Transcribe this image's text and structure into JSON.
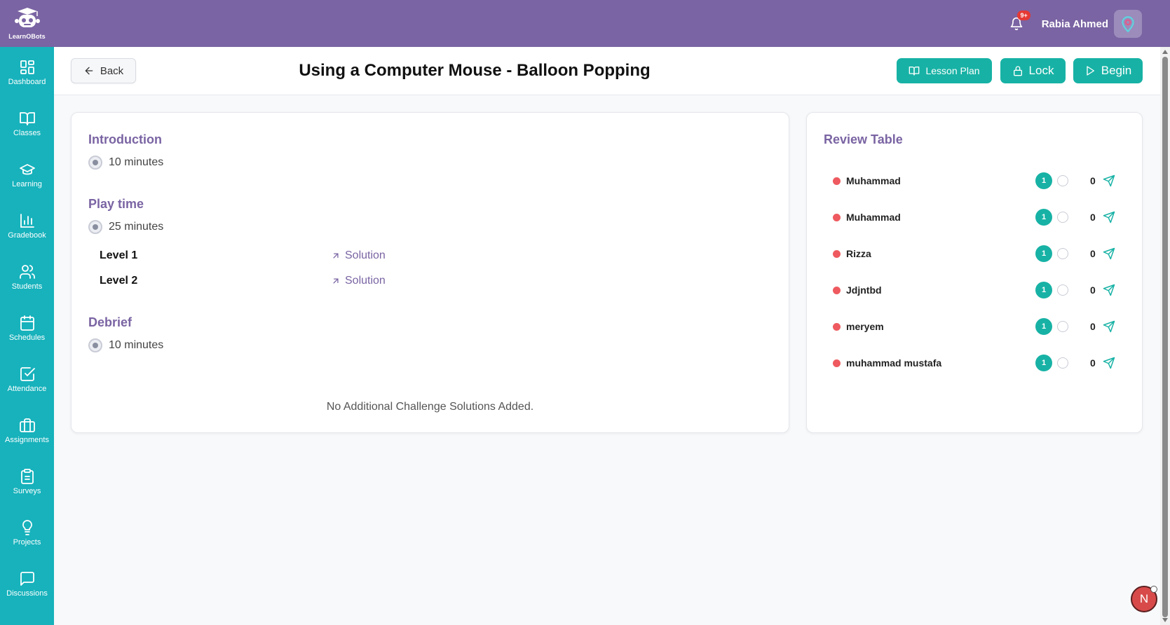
{
  "brand": {
    "name": "LearnOBots"
  },
  "topbar": {
    "notif_badge": "9+",
    "user_name": "Rabia Ahmed"
  },
  "sidebar": {
    "items": [
      {
        "label": "Dashboard",
        "icon": "dashboard-icon"
      },
      {
        "label": "Classes",
        "icon": "book-icon"
      },
      {
        "label": "Learning",
        "icon": "graduation-cap-icon"
      },
      {
        "label": "Gradebook",
        "icon": "bar-chart-icon"
      },
      {
        "label": "Students",
        "icon": "users-icon"
      },
      {
        "label": "Schedules",
        "icon": "calendar-icon"
      },
      {
        "label": "Attendance",
        "icon": "check-square-icon"
      },
      {
        "label": "Assignments",
        "icon": "briefcase-icon"
      },
      {
        "label": "Surveys",
        "icon": "clipboard-icon"
      },
      {
        "label": "Projects",
        "icon": "lightbulb-icon"
      },
      {
        "label": "Discussions",
        "icon": "message-icon"
      }
    ]
  },
  "header": {
    "back_label": "Back",
    "title": "Using a Computer Mouse - Balloon Popping",
    "lesson_plan_label": "Lesson Plan",
    "lock_label": "Lock",
    "begin_label": "Begin"
  },
  "lesson": {
    "introduction": {
      "title": "Introduction",
      "duration": "10 minutes"
    },
    "playtime": {
      "title": "Play time",
      "duration": "25 minutes",
      "levels": [
        {
          "name": "Level 1",
          "link": "Solution"
        },
        {
          "name": "Level 2",
          "link": "Solution"
        }
      ]
    },
    "debrief": {
      "title": "Debrief",
      "duration": "10 minutes"
    },
    "no_solutions": "No Additional Challenge Solutions Added."
  },
  "review": {
    "title": "Review Table",
    "students": [
      {
        "name": "Muhammad",
        "count": "1",
        "score": "0"
      },
      {
        "name": "Muhammad",
        "count": "1",
        "score": "0"
      },
      {
        "name": "Rizza",
        "count": "1",
        "score": "0"
      },
      {
        "name": "Jdjntbd",
        "count": "1",
        "score": "0"
      },
      {
        "name": "meryem",
        "count": "1",
        "score": "0"
      },
      {
        "name": "muhammad mustafa",
        "count": "1",
        "score": "0"
      }
    ]
  },
  "fab": {
    "letter": "N"
  },
  "colors": {
    "topbar": "#7a64a3",
    "sidebar": "#17b2bc",
    "accent": "#17b2a5",
    "status_red": "#ee5a5f"
  }
}
